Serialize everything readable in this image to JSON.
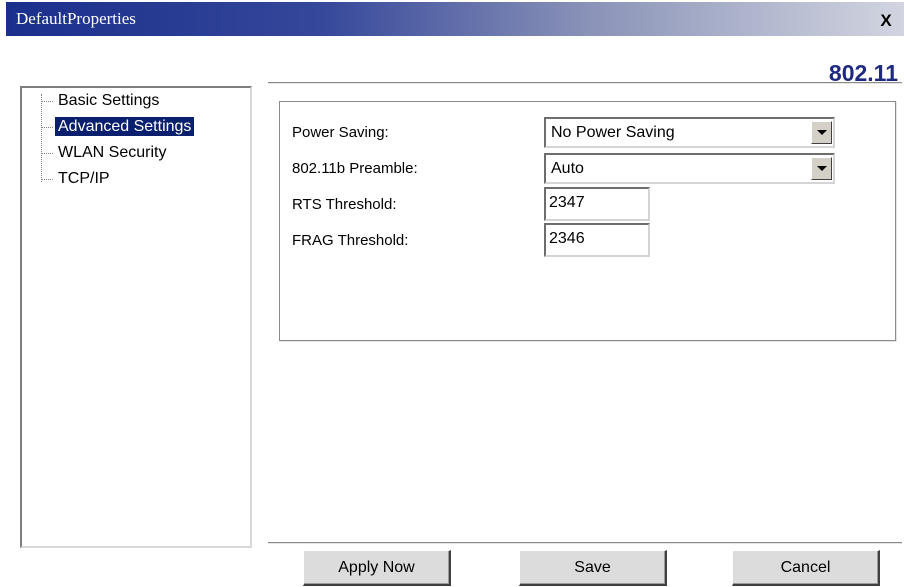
{
  "window": {
    "title": "DefaultProperties",
    "close_glyph": "X"
  },
  "header": {
    "banner": "802.11"
  },
  "tree": {
    "items": [
      {
        "label": "Basic Settings",
        "selected": false
      },
      {
        "label": "Advanced Settings",
        "selected": true
      },
      {
        "label": "WLAN Security",
        "selected": false
      },
      {
        "label": "TCP/IP",
        "selected": false
      }
    ]
  },
  "settings": {
    "power_saving": {
      "label": "Power Saving:",
      "value": "No Power Saving"
    },
    "preamble": {
      "label": "802.11b Preamble:",
      "value": "Auto"
    },
    "rts_threshold": {
      "label": "RTS Threshold:",
      "value": "2347"
    },
    "frag_threshold": {
      "label": "FRAG Threshold:",
      "value": "2346"
    }
  },
  "buttons": {
    "apply": "Apply Now",
    "save": "Save",
    "cancel": "Cancel"
  },
  "colors": {
    "title_gradient_start": "#1a2f8c",
    "selection": "#0a1f6e",
    "banner": "#1e2a80"
  }
}
